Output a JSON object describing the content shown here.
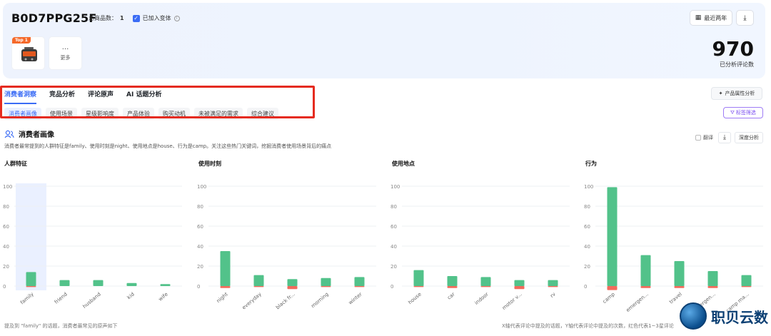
{
  "header": {
    "asin": "B0D7PPG25F",
    "total_label": "总商品数：",
    "total_value": "1",
    "variant_label": "已加入变体",
    "date_btn": "最近两年",
    "top_badge": "Top 1",
    "more_dots": "···",
    "more_label": "更多",
    "review_count": "970",
    "review_count_label": "已分析评论数"
  },
  "tabs": [
    {
      "label": "消费者洞察",
      "active": true
    },
    {
      "label": "竞品分析",
      "active": false
    },
    {
      "label": "评论原声",
      "active": false
    },
    {
      "label": "AI 话题分析",
      "active": false
    }
  ],
  "subtabs": [
    {
      "label": "消费者画像",
      "active": true
    },
    {
      "label": "使用场景",
      "active": false
    },
    {
      "label": "星级影响度",
      "active": false
    },
    {
      "label": "产品体验",
      "active": false
    },
    {
      "label": "购买动机",
      "active": false
    },
    {
      "label": "未被满足的需求",
      "active": false
    },
    {
      "label": "综合建议",
      "active": false
    }
  ],
  "buttons": {
    "product_attr": "产品属性分析",
    "tag_filter": "标签筛选",
    "translate": "翻译",
    "deep_analysis": "深度分析"
  },
  "section": {
    "title": "消费者画像",
    "desc": "消费者最常提到的人群特征是family、使用时刻是night、使用地点是house、行为是camp。关注这些热门关键词，挖掘消费者使用场景背后的痛点"
  },
  "chart_data": [
    {
      "type": "bar",
      "title": "人群特征",
      "categories": [
        "family",
        "friend",
        "husband",
        "kid",
        "wife"
      ],
      "ylim": [
        0,
        100
      ],
      "yticks": [
        0,
        20,
        40,
        60,
        80,
        100
      ],
      "series": [
        {
          "values": [
            14,
            6,
            6,
            3,
            2
          ]
        },
        {
          "values": [
            1,
            0,
            0,
            0,
            0
          ]
        }
      ],
      "highlight": "family",
      "grid": true
    },
    {
      "type": "bar",
      "title": "使用时刻",
      "categories": [
        "night",
        "everyday",
        "black fr...",
        "morning",
        "winter"
      ],
      "ylim": [
        0,
        100
      ],
      "yticks": [
        0,
        20,
        40,
        60,
        80,
        100
      ],
      "series": [
        {
          "values": [
            35,
            11,
            7,
            8,
            9
          ]
        },
        {
          "values": [
            2,
            1,
            3,
            1,
            1
          ]
        }
      ],
      "grid": true
    },
    {
      "type": "bar",
      "title": "使用地点",
      "categories": [
        "house",
        "car",
        "indoor",
        "motor v...",
        "rv"
      ],
      "ylim": [
        0,
        100
      ],
      "yticks": [
        0,
        20,
        40,
        60,
        80,
        100
      ],
      "series": [
        {
          "values": [
            16,
            10,
            9,
            6,
            6
          ]
        },
        {
          "values": [
            1,
            2,
            1,
            3,
            1
          ]
        }
      ],
      "grid": true
    },
    {
      "type": "bar",
      "title": "行为",
      "categories": [
        "camp",
        "emergen...",
        "travel",
        "emergen...",
        "camp ma..."
      ],
      "ylim": [
        0,
        100
      ],
      "yticks": [
        0,
        20,
        40,
        60,
        80,
        100
      ],
      "series": [
        {
          "values": [
            99,
            31,
            25,
            15,
            11
          ]
        },
        {
          "values": [
            4,
            2,
            2,
            2,
            1
          ]
        }
      ],
      "grid": true
    }
  ],
  "footer": {
    "left": "提及到 \"family\" 的话题，消费者最常见的原声如下",
    "right": "X轴代表评论中提及的话题，Y轴代表评论中提及的次数，红色代表1~3星评论"
  },
  "watermark": "职贝云数",
  "colors": {
    "accent": "#3b6cf5",
    "positive": "#52c28a",
    "negative": "#f26b5c",
    "highlight": "#eaf0ff",
    "redbox": "#e52b1f"
  }
}
